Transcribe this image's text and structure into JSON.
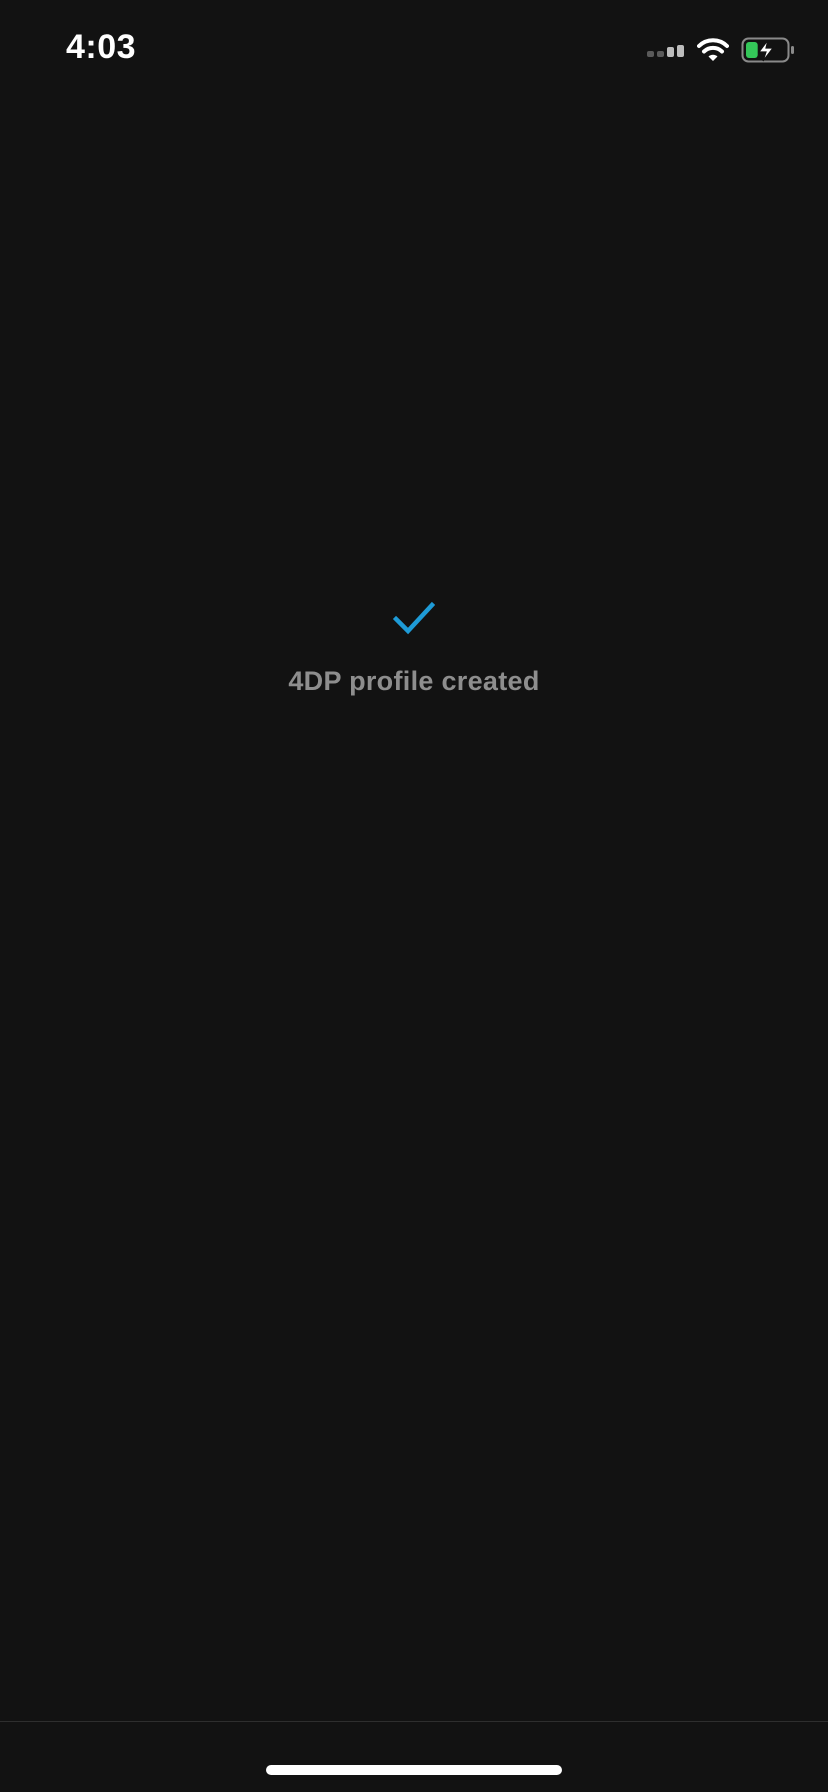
{
  "status_bar": {
    "time": "4:03",
    "icons": [
      "signal-icon",
      "wifi-icon",
      "battery-charging-icon"
    ],
    "battery_fill_fraction": 0.3,
    "battery_color": "#34c759"
  },
  "confirmation": {
    "icon": "check-icon",
    "icon_color": "#1e9bd7",
    "message": "4DP profile created",
    "message_color": "#8e8e8e"
  },
  "colors": {
    "background": "#121212"
  }
}
